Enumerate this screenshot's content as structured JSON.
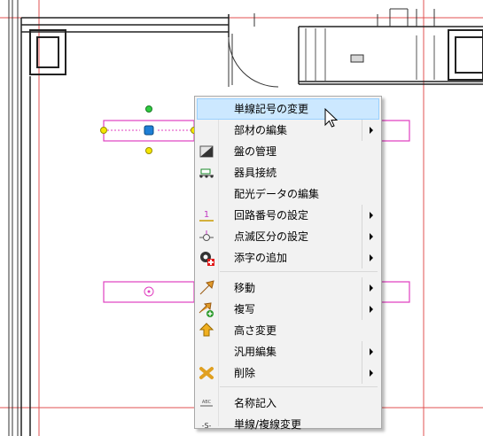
{
  "context_menu": {
    "items": [
      {
        "label": "単線記号の変更",
        "icon": "none",
        "submenu": false,
        "highlighted": true
      },
      {
        "label": "部材の編集",
        "icon": "none",
        "submenu": true
      },
      {
        "label": "盤の管理",
        "icon": "panel-icon",
        "submenu": false
      },
      {
        "label": "器具接続",
        "icon": "fixture-connect-icon",
        "submenu": false
      },
      {
        "label": "配光データの編集",
        "icon": "none",
        "submenu": false
      },
      {
        "label": "回路番号の設定",
        "icon": "circuit-number-icon",
        "submenu": true
      },
      {
        "label": "点滅区分の設定",
        "icon": "switch-group-icon",
        "submenu": true
      },
      {
        "label": "添字の追加",
        "icon": "subscript-icon",
        "submenu": true
      },
      {
        "label": "移動",
        "icon": "move-icon",
        "submenu": true
      },
      {
        "label": "複写",
        "icon": "copy-icon",
        "submenu": true
      },
      {
        "label": "高さ変更",
        "icon": "height-icon",
        "submenu": false
      },
      {
        "label": "汎用編集",
        "icon": "none",
        "submenu": true
      },
      {
        "label": "削除",
        "icon": "delete-icon",
        "submenu": true
      },
      {
        "label": "名称記入",
        "icon": "name-entry-icon",
        "submenu": false
      },
      {
        "label": "単線/複線変更",
        "icon": "single-double-line-icon",
        "submenu": false
      }
    ]
  },
  "icons": {
    "circuit_number_text": "1",
    "single_double_line_text": "-S-"
  },
  "colors": {
    "highlight_bg": "#cce8ff",
    "highlight_border": "#99d1ff",
    "grid_red": "#e05050",
    "fixture_pink": "#e040c0",
    "handle_green": "#2ecc40",
    "handle_yellow": "#f5e600",
    "handle_blue": "#1e7fd6"
  }
}
